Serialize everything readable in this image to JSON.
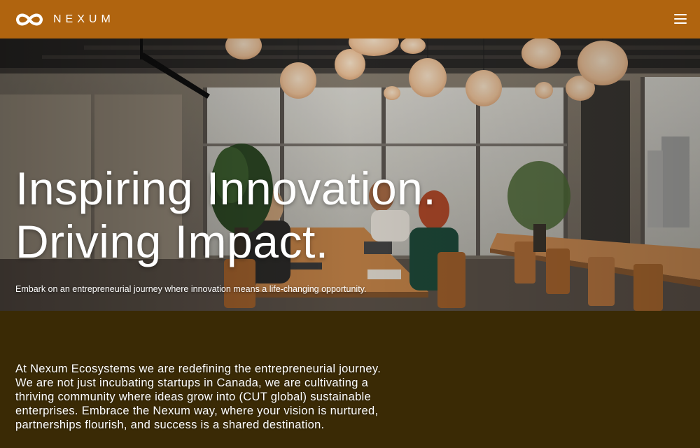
{
  "header": {
    "brand_name": "NEXUM",
    "logo_icon": "infinity-logo-icon",
    "menu_icon": "hamburger-menu-icon",
    "background_color": "#b0640f"
  },
  "hero": {
    "title_line_1": "Inspiring Innovation.",
    "title_line_2": "Driving Impact.",
    "subtitle": "Embark on an entrepreneurial journey where innovation means a life-changing opportunity."
  },
  "about": {
    "paragraph": "At Nexum Ecosystems we are redefining the entrepreneurial journey. We are not just incubating startups in Canada, we are cultivating a thriving community where ideas grow into (CUT global) sustainable enterprises. Embrace the Nexum way, where your vision is nurtured, partnerships flourish, and success is a shared destination.",
    "background_color": "#3a2a05"
  }
}
